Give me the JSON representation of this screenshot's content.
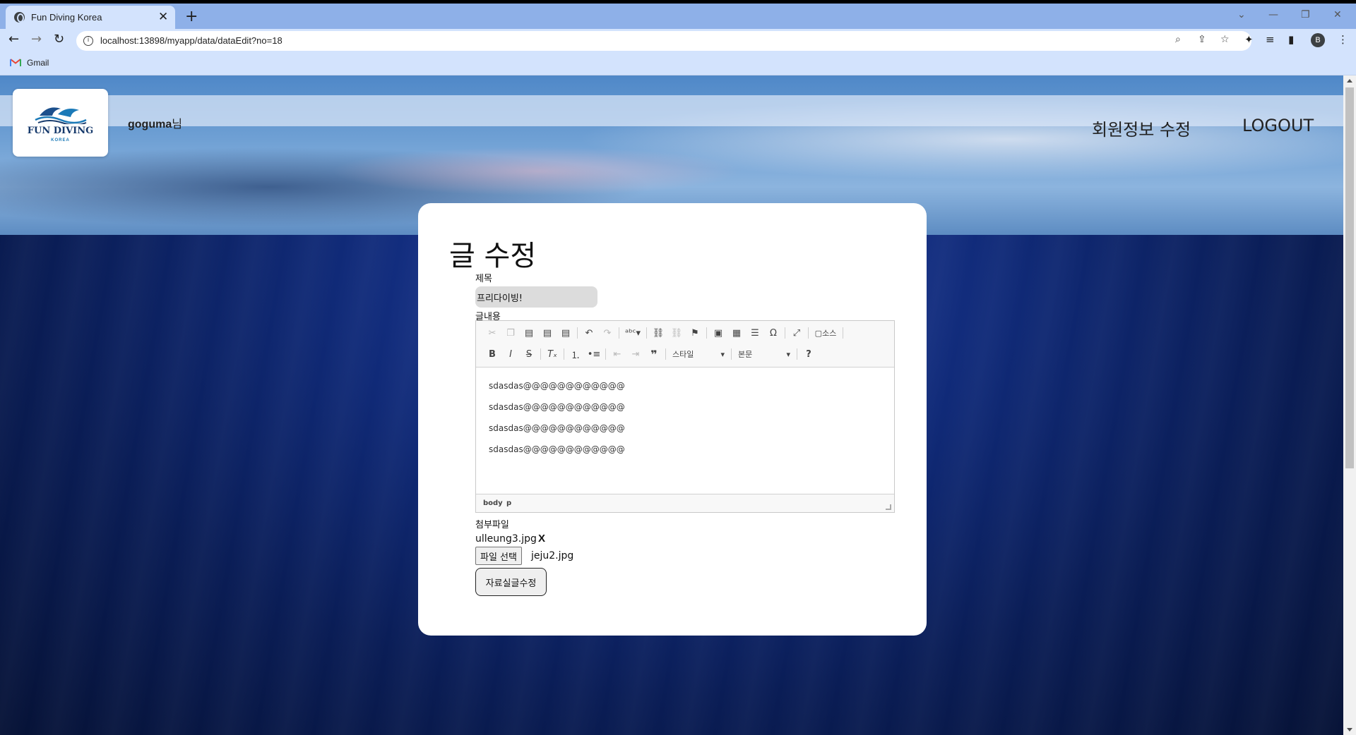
{
  "browser": {
    "tab_title": "Fun Diving Korea",
    "tab_close": "✕",
    "new_tab": "+",
    "url": "localhost:13898/myapp/data/dataEdit?no=18",
    "bookmark_gmail": "Gmail",
    "profile_initial": "B",
    "icons": [
      "back-icon",
      "forward-icon",
      "reload-icon",
      "info-icon",
      "zoom-icon",
      "share-icon",
      "bookmark-star-icon",
      "extensions-icon",
      "media-icon",
      "sidepanel-icon",
      "menu-icon"
    ]
  },
  "header": {
    "logo_text": "FUN DIVING",
    "logo_sub": "KOREA",
    "user_name": "goguma",
    "user_suffix": "님",
    "nav_edit_profile": "회원정보 수정",
    "nav_logout": "LOGOUT"
  },
  "form": {
    "heading": "글 수정",
    "title_label": "제목",
    "title_value": "프리다이빙!",
    "content_label": "글내용",
    "content_lines": [
      "sdasdas@@@@@@@@@@@@",
      "sdasdas@@@@@@@@@@@@",
      "sdasdas@@@@@@@@@@@@",
      "sdasdas@@@@@@@@@@@@"
    ],
    "editor_style_combo": "스타일",
    "editor_format_combo": "본문",
    "editor_source_label": "소스",
    "editor_path": [
      "body",
      "p"
    ],
    "attach_label": "첨부파일",
    "existing_file": "ulleung3.jpg",
    "delete_file": "X",
    "file_button": "파일 선택",
    "chosen_file": "jeju2.jpg",
    "submit_label": "자료실글수정"
  }
}
